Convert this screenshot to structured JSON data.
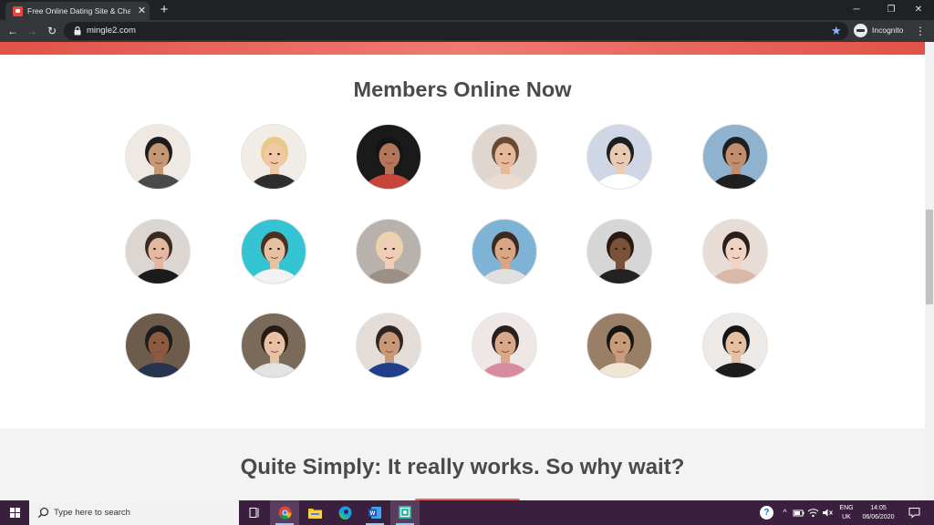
{
  "browser": {
    "tab_title": "Free Online Dating Site & Chat A",
    "tab_close": "✕",
    "new_tab": "+",
    "url": "mingle2.com",
    "profile_label": "Incognito",
    "window_controls": {
      "minimize": "─",
      "restore": "❐",
      "close": "✕"
    },
    "nav": {
      "back": "←",
      "forward": "→",
      "reload": "↻"
    },
    "bookmark_star": "★",
    "menu": "⋮"
  },
  "page": {
    "accent_color": "#e25248",
    "members_title": "Members Online Now",
    "cta_title": "Quite Simply: It really works. So why wait?",
    "members": [
      {
        "name": "member-photo-1",
        "bg": "#efe9e4",
        "skin": "#c69774",
        "hair": "#1c1c1c",
        "shirt": "#4a4a4a"
      },
      {
        "name": "member-photo-2",
        "bg": "#f1ece6",
        "skin": "#f0c8a6",
        "hair": "#e7c98a",
        "shirt": "#2e2e2e"
      },
      {
        "name": "member-photo-3",
        "bg": "#1a1a1a",
        "skin": "#b4765a",
        "hair": "#141414",
        "shirt": "#c8453c"
      },
      {
        "name": "member-photo-4",
        "bg": "#dfd7cf",
        "skin": "#e6b99a",
        "hair": "#6b4a33",
        "shirt": "#e9ddd2"
      },
      {
        "name": "member-photo-5",
        "bg": "#cfd6e6",
        "skin": "#e9cbb4",
        "hair": "#1e1e1e",
        "shirt": "#ffffff"
      },
      {
        "name": "member-photo-6",
        "bg": "#8fb2cf",
        "skin": "#c48e6e",
        "hair": "#1f1f1f",
        "shirt": "#1f1f1f"
      },
      {
        "name": "member-photo-7",
        "bg": "#dcd6d2",
        "skin": "#e2b9a0",
        "hair": "#3b2a22",
        "shirt": "#1b1b1b"
      },
      {
        "name": "member-photo-8",
        "bg": "#35c4d4",
        "skin": "#e6c0a0",
        "hair": "#4a3121",
        "shirt": "#f2f2f2"
      },
      {
        "name": "member-photo-9",
        "bg": "#b9b1ab",
        "skin": "#efcdb6",
        "hair": "#e8d3aa",
        "shirt": "#9b8f86"
      },
      {
        "name": "member-photo-10",
        "bg": "#7fb3d6",
        "skin": "#d8a585",
        "hair": "#3a2a20",
        "shirt": "#e0e0e0"
      },
      {
        "name": "member-photo-11",
        "bg": "#d6d6d6",
        "skin": "#7a5139",
        "hair": "#2a1a12",
        "shirt": "#222222"
      },
      {
        "name": "member-photo-12",
        "bg": "#e7dcd6",
        "skin": "#f0d3c2",
        "hair": "#2a1f1c",
        "shirt": "#d9b8a8"
      },
      {
        "name": "member-photo-13",
        "bg": "#6d5b4c",
        "skin": "#8b5a3f",
        "hair": "#1c1c1c",
        "shirt": "#28344f"
      },
      {
        "name": "member-photo-14",
        "bg": "#7a6a5a",
        "skin": "#e6c1a3",
        "hair": "#2a1a14",
        "shirt": "#e3e3e3"
      },
      {
        "name": "member-photo-15",
        "bg": "#e4dcd6",
        "skin": "#c8987a",
        "hair": "#2f2420",
        "shirt": "#1f3f8c"
      },
      {
        "name": "member-photo-16",
        "bg": "#efe6e6",
        "skin": "#d8a888",
        "hair": "#2a1f1c",
        "shirt": "#d78aa0"
      },
      {
        "name": "member-photo-17",
        "bg": "#9a7f67",
        "skin": "#c99b78",
        "hair": "#161616",
        "shirt": "#efe6d6"
      },
      {
        "name": "member-photo-18",
        "bg": "#ece9e6",
        "skin": "#e6c0a2",
        "hair": "#151515",
        "shirt": "#1d1d1d"
      }
    ]
  },
  "taskbar": {
    "search_placeholder": "Type here to search",
    "language": "ENG",
    "region": "UK",
    "time": "14:05",
    "date": "06/06/2020",
    "colors": {
      "bar": "#3a1f3f",
      "active": "#5a3d5e"
    }
  }
}
